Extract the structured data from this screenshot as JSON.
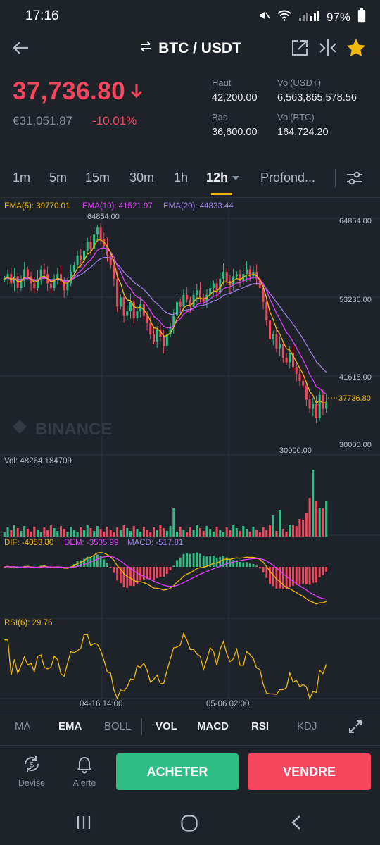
{
  "status": {
    "time": "17:16",
    "battery": "97%"
  },
  "header": {
    "title": "BTC / USDT"
  },
  "price": {
    "last": "37,736.80",
    "fiat": "€31,051.87",
    "change": "-10.01%",
    "high_label": "Haut",
    "high": "42,200.00",
    "low_label": "Bas",
    "low": "36,600.00",
    "vol_usdt_label": "Vol(USDT)",
    "vol_usdt": "6,563,865,578.56",
    "vol_btc_label": "Vol(BTC)",
    "vol_btc": "164,724.20"
  },
  "timeframes": {
    "items": [
      "1m",
      "5m",
      "15m",
      "30m",
      "1h",
      "12h",
      "Profond..."
    ],
    "active": "12h"
  },
  "chart": {
    "ema5": "EMA(5): 39770.01",
    "ema10": "EMA(10): 41521.97",
    "ema20": "EMA(20): 44833.44",
    "max_label": "64854.00",
    "min_label": "30000.00",
    "axis": [
      "64854.00",
      "53236.00",
      "41618.00",
      "30000.00"
    ],
    "last_tag": "37736.80",
    "watermark": "BINANCE",
    "vol": "Vol: 48264.184709",
    "dif": "DIF: -4053.80",
    "dem": "DEM: -3535.99",
    "macd": "MACD: -517.81",
    "rsi": "RSI(6): 29.76",
    "date1": "04-16 14:00",
    "date2": "05-06 02:00",
    "colors": {
      "up": "#2ebd85",
      "down": "#f6465d",
      "ema5": "#f0b90b",
      "ema10": "#e040fb",
      "ema20": "#9c7ee8"
    }
  },
  "chart_data": {
    "type": "candlestick",
    "ylim": [
      30000,
      64854
    ],
    "last_price": 37736.8,
    "high_price": 64854.0,
    "low_price": 30000.0
  },
  "indicators": {
    "items": [
      "MA",
      "EMA",
      "BOLL",
      "VOL",
      "MACD",
      "RSI",
      "KDJ"
    ],
    "active": [
      "EMA",
      "VOL",
      "MACD",
      "RSI"
    ]
  },
  "actions": {
    "devise": "Devise",
    "alerte": "Alerte",
    "buy": "ACHETER",
    "sell": "VENDRE"
  }
}
